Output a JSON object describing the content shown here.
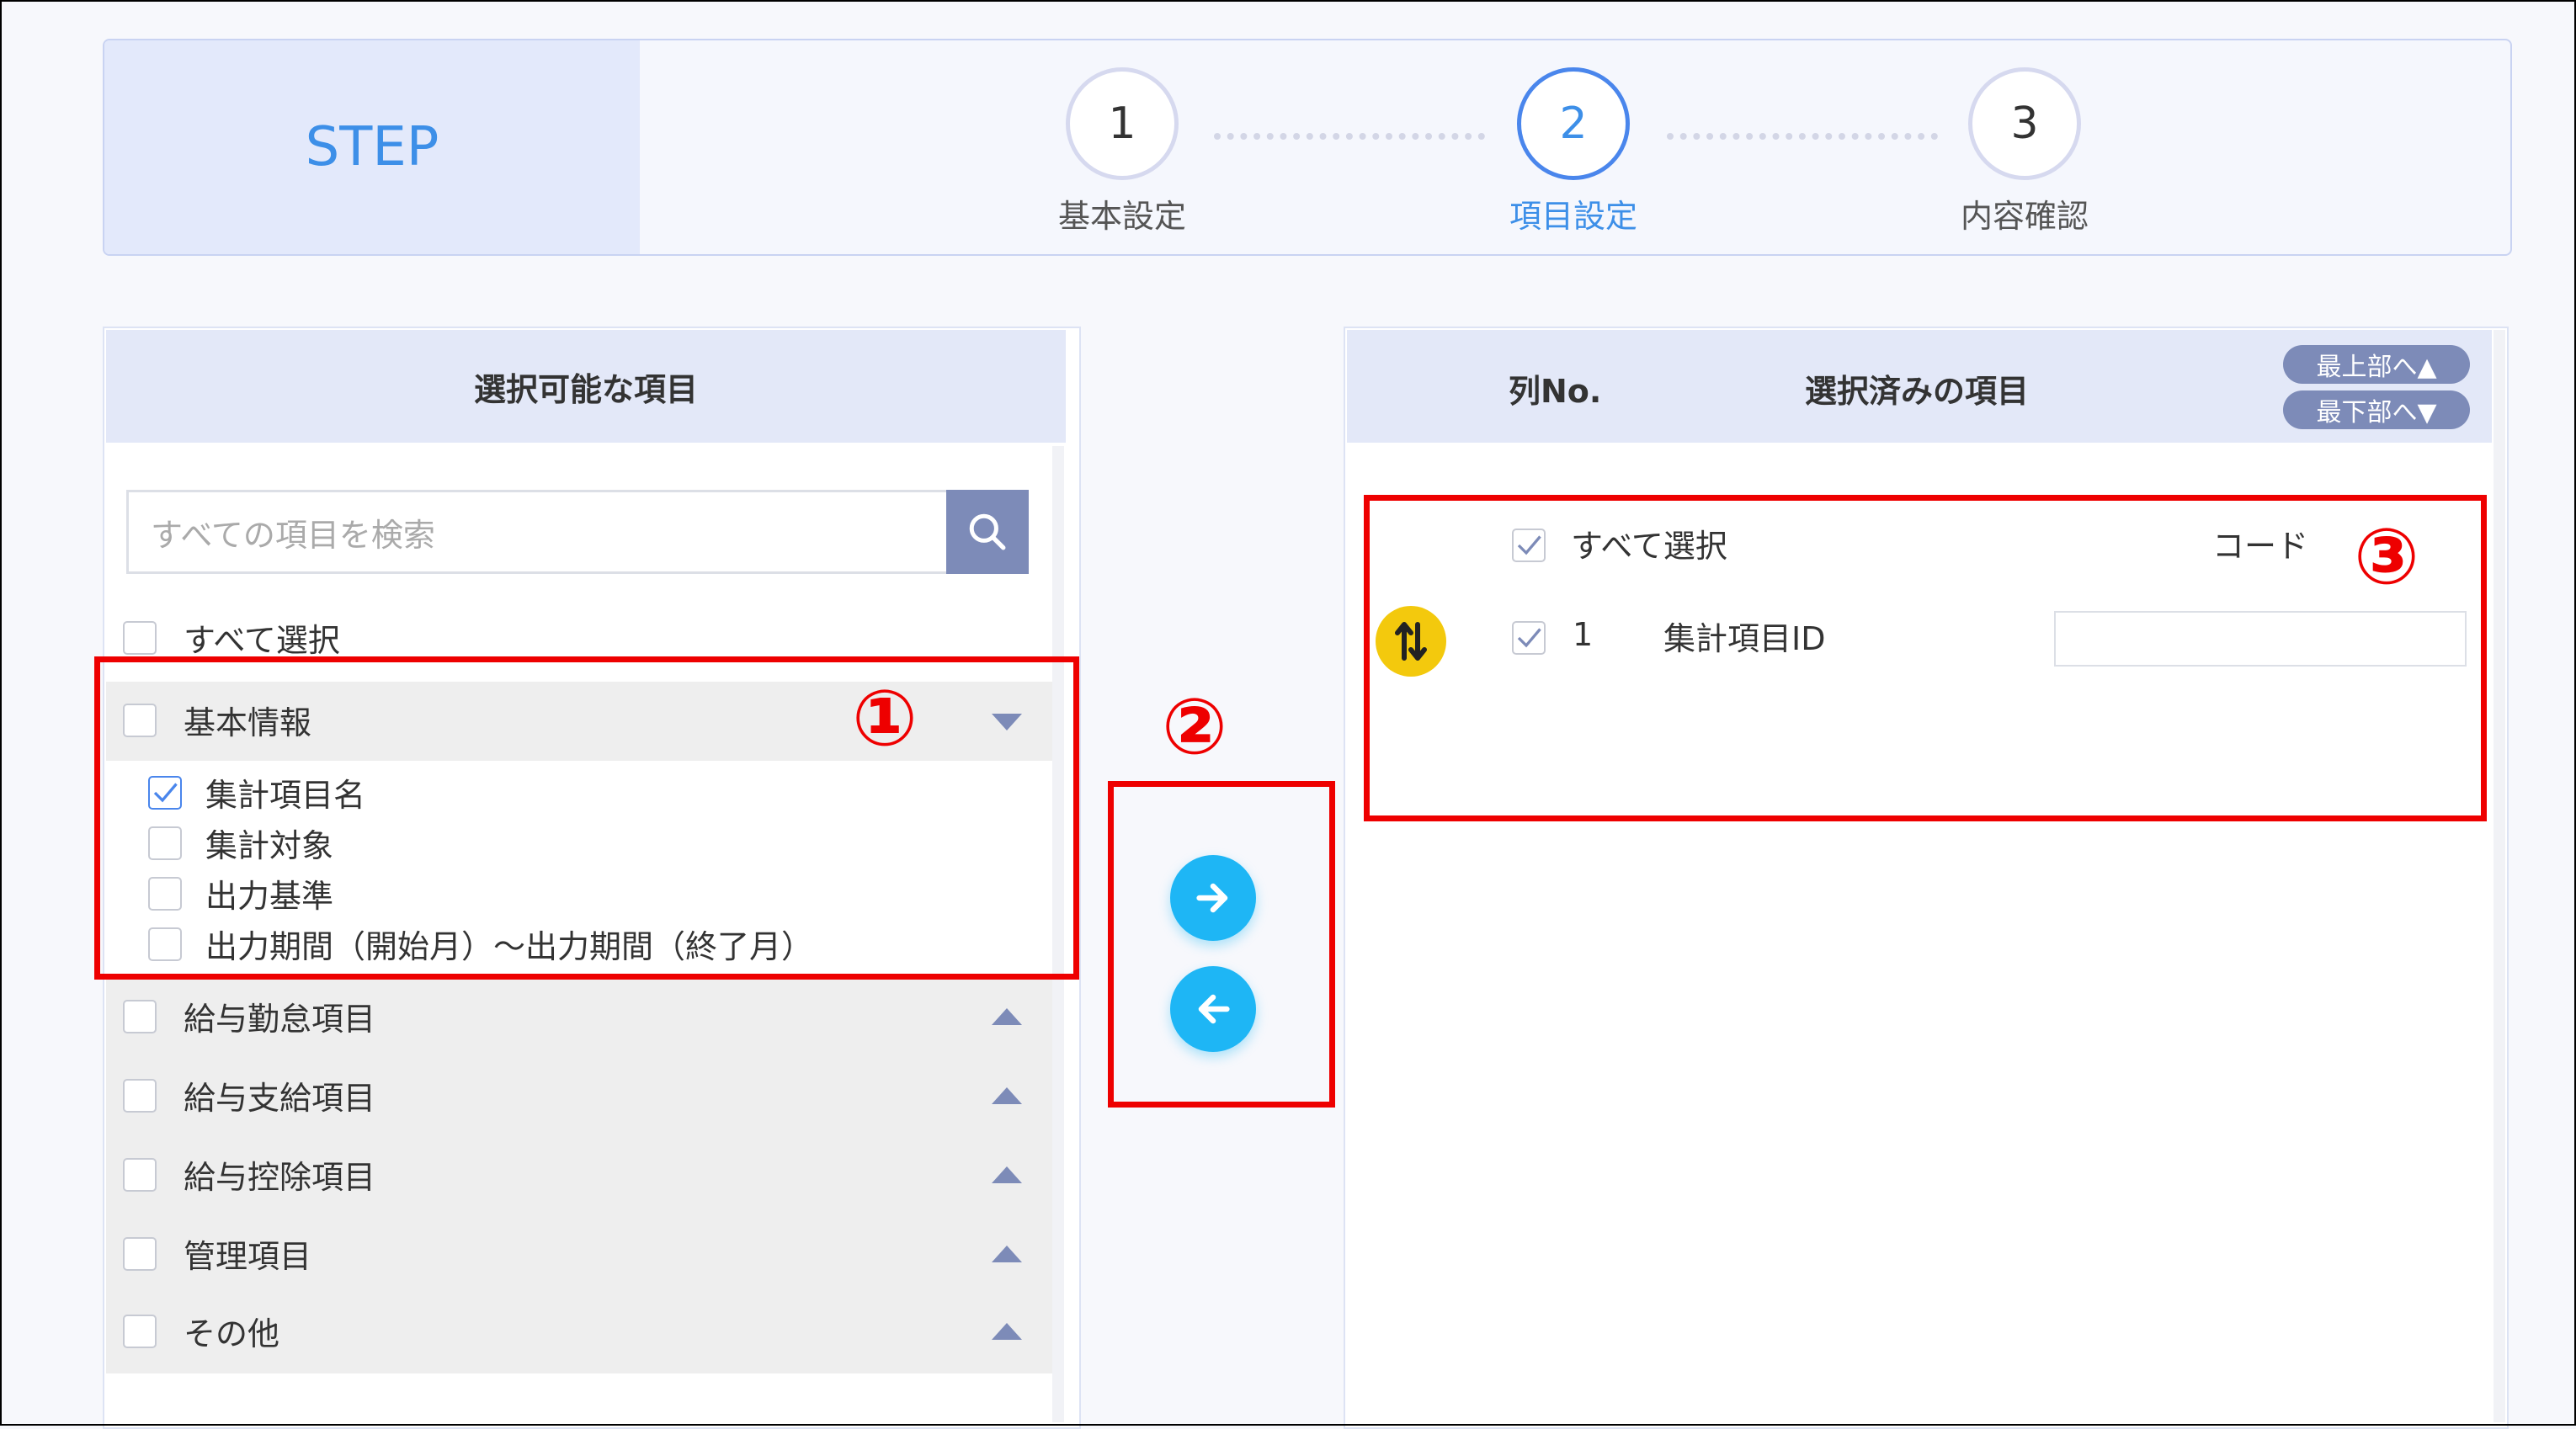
{
  "steps": {
    "title": "STEP",
    "items": [
      {
        "number": "1",
        "label": "基本設定"
      },
      {
        "number": "2",
        "label": "項目設定"
      },
      {
        "number": "3",
        "label": "内容確認"
      }
    ]
  },
  "left_panel": {
    "header": "選択可能な項目",
    "search_placeholder": "すべての項目を検索",
    "select_all_label": "すべて選択",
    "expanded_group": {
      "label": "基本情報",
      "items": [
        {
          "label": "集計項目名",
          "checked": true
        },
        {
          "label": "集計対象",
          "checked": false
        },
        {
          "label": "出力基準",
          "checked": false
        },
        {
          "label": "出力期間（開始月）～出力期間（終了月）",
          "checked": false
        }
      ]
    },
    "collapsed_groups": [
      "給与勤怠項目",
      "給与支給項目",
      "給与控除項目",
      "管理項目",
      "その他"
    ]
  },
  "transfer": {
    "add_icon": "arrow-right-icon",
    "remove_icon": "arrow-left-icon"
  },
  "right_panel": {
    "col_no_header": "列No.",
    "header": "選択済みの項目",
    "to_top_label": "最上部へ▲",
    "to_bottom_label": "最下部へ▼",
    "select_all_label": "すべて選択",
    "code_header": "コード",
    "rows": [
      {
        "checked": true,
        "no": "1",
        "name": "集計項目ID",
        "code": ""
      }
    ]
  },
  "annotations": {
    "marker1": "①",
    "marker2": "②",
    "marker3": "③"
  },
  "colors": {
    "accent": "#3d8fe8",
    "annotation_red": "#ee0000",
    "button_cyan": "#1eb6f5",
    "slate": "#7d8bb8",
    "handle_yellow": "#f3c90d"
  }
}
